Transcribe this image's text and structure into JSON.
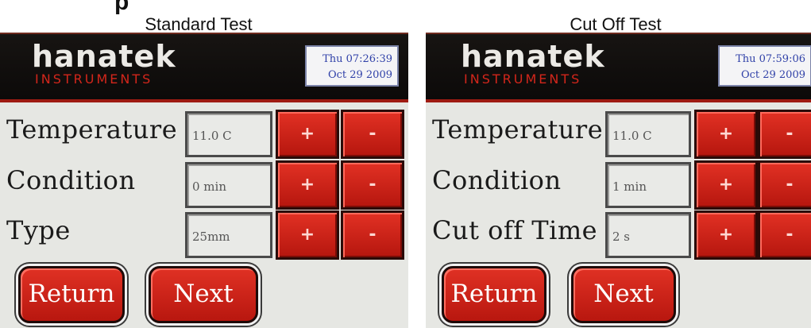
{
  "captions": {
    "left": "Standard Test",
    "right": "Cut Off Test"
  },
  "page_heading_fragment": "p",
  "screens": [
    {
      "logo": {
        "word": "hanatek",
        "sub": "INSTRUMENTS"
      },
      "clock": {
        "time": "Thu 07:26:39",
        "date": "Oct 29  2009"
      },
      "rows": [
        {
          "label": "Temperature",
          "value": "11.0 C",
          "plus": "+",
          "minus": "-"
        },
        {
          "label": "Condition",
          "value": "0 min",
          "plus": "+",
          "minus": "-"
        },
        {
          "label": "Type",
          "value": "25mm",
          "plus": "+",
          "minus": "-"
        }
      ],
      "buttons": {
        "return": "Return",
        "next": "Next"
      }
    },
    {
      "logo": {
        "word": "hanatek",
        "sub": "INSTRUMENTS"
      },
      "clock": {
        "time": "Thu 07:59:06",
        "date": "Oct 29  2009"
      },
      "rows": [
        {
          "label": "Temperature",
          "value": "11.0 C",
          "plus": "+",
          "minus": "-"
        },
        {
          "label": "Condition",
          "value": "1 min",
          "plus": "+",
          "minus": "-"
        },
        {
          "label": "Cut off Time",
          "value": "2 s",
          "plus": "+",
          "minus": "-"
        }
      ],
      "buttons": {
        "return": "Return",
        "next": "Next"
      }
    }
  ],
  "colors": {
    "accent_red": "#d3261b",
    "header_black": "#120f0d",
    "panel_grey": "#e6e7e3",
    "clock_blue": "#3041a8"
  }
}
